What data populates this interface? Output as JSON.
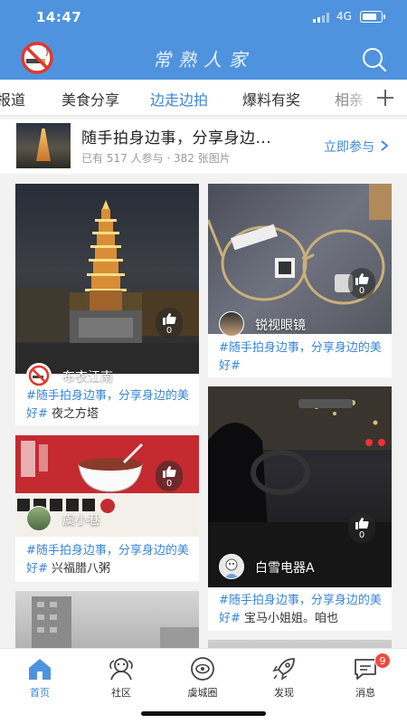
{
  "status": {
    "time": "14:47",
    "network": "4G"
  },
  "header": {
    "title": "常熟人家",
    "logo_icon": "no-smoking-icon",
    "search_icon": "search-icon"
  },
  "tabs": [
    {
      "label": "报道",
      "active": false
    },
    {
      "label": "美食分享",
      "active": false
    },
    {
      "label": "边走边拍",
      "active": true
    },
    {
      "label": "爆料有奖",
      "active": false
    },
    {
      "label": "相亲",
      "active": false
    }
  ],
  "topic": {
    "title": "随手拍身边事，分享身边...",
    "meta": "已有 517 人参与 · 382 张图片",
    "join_label": "立即参与"
  },
  "cards": [
    {
      "author": "布衣江南",
      "likes": "0",
      "tag": "#随手拍身边事，分享身边的美好#",
      "text": " 夜之方塔"
    },
    {
      "author": "锐视眼镜",
      "likes": "0",
      "tag": "#随手拍身边事，分享身边的美好#",
      "text": ""
    },
    {
      "author": "虞小巷",
      "likes": "0",
      "tag": "#随手拍身边事，分享身边的美好#",
      "text": " 兴福腊八粥"
    },
    {
      "author": "白雪电器A",
      "likes": "0",
      "tag": "#随手拍身边事，分享身边的美好#",
      "text": " 宝马小姐姐。咱也"
    }
  ],
  "bottom_nav": [
    {
      "label": "首页",
      "icon": "home-icon",
      "active": true
    },
    {
      "label": "社区",
      "icon": "community-icon",
      "active": false
    },
    {
      "label": "虞城圈",
      "icon": "circle-icon",
      "active": false
    },
    {
      "label": "发现",
      "icon": "rocket-icon",
      "active": false
    },
    {
      "label": "消息",
      "icon": "message-icon",
      "active": false,
      "badge": "9"
    }
  ],
  "colors": {
    "brand": "#4f93de",
    "accent": "#3a86d6",
    "badge": "#f04a3e"
  }
}
